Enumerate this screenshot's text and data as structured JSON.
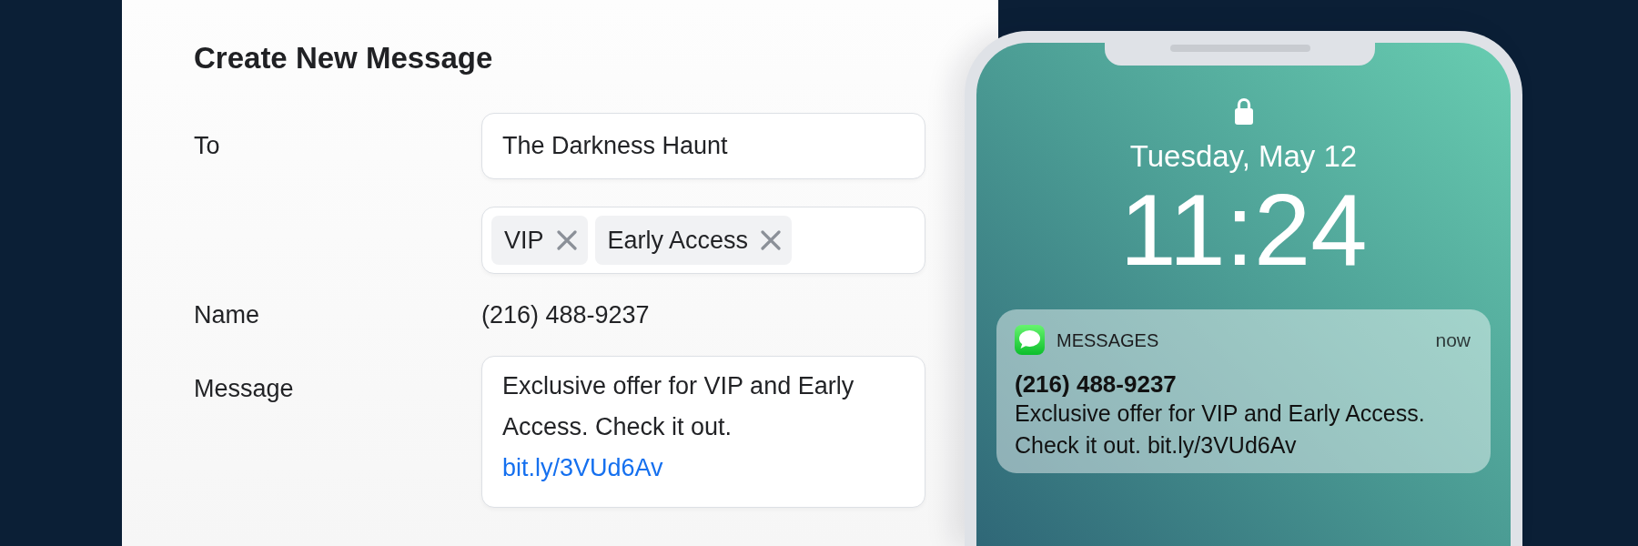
{
  "form": {
    "title": "Create New Message",
    "fields": [
      {
        "kind": "input",
        "label": "To",
        "value": "The Darkness Haunt"
      },
      {
        "kind": "tags",
        "tags": [
          {
            "label": "VIP"
          },
          {
            "label": "Early Access"
          }
        ]
      },
      {
        "kind": "text",
        "label": "Name",
        "value": "(216) 488-9237"
      },
      {
        "kind": "textarea",
        "label": "Message",
        "value": "Exclusive offer for VIP and Early Access. Check it out.",
        "link": "bit.ly/3VUd6Av"
      }
    ]
  },
  "phone": {
    "date": "Tuesday, May 12",
    "time": "11:24",
    "notification": {
      "app": "MESSAGES",
      "time": "now",
      "sender": "(216) 488-9237",
      "body": "Exclusive offer for VIP and Early Access. Check it out. bit.ly/3VUd6Av"
    }
  }
}
